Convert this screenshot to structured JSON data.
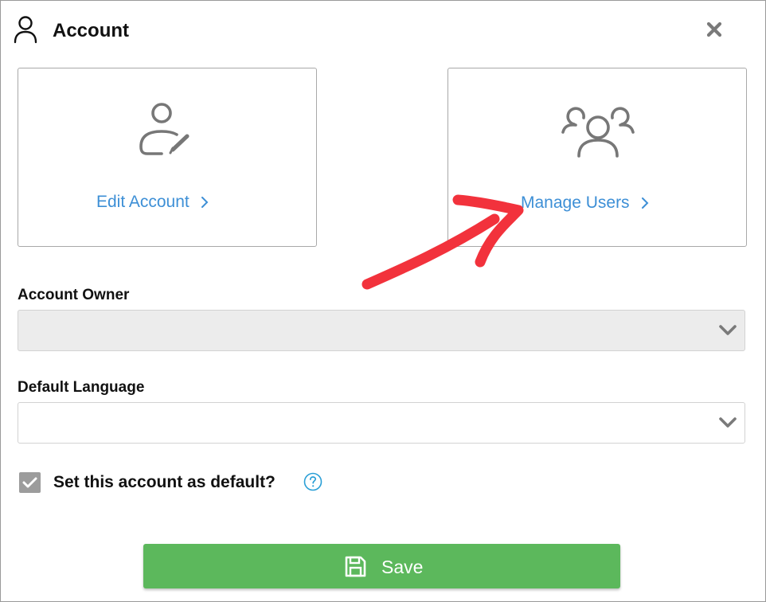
{
  "dialog": {
    "title": "Account",
    "title_icon": "user-icon",
    "close_icon": "close-icon"
  },
  "cards": [
    {
      "label": "Edit Account",
      "icon": "user-edit-icon",
      "chevron": "chevron-right-icon"
    },
    {
      "label": "Manage Users",
      "icon": "users-group-icon",
      "chevron": "chevron-right-icon"
    }
  ],
  "form": {
    "account_owner": {
      "label": "Account Owner",
      "value": "",
      "disabled": true
    },
    "default_language": {
      "label": "Default Language",
      "value": ""
    },
    "set_default": {
      "label": "Set this account as default?",
      "checked": true,
      "help_icon": "help-icon"
    }
  },
  "save_button": {
    "label": "Save",
    "icon": "floppy-disk-icon",
    "color": "#5cb85c"
  },
  "colors": {
    "link": "#3d8fd6",
    "annotation_arrow": "#f2323c"
  }
}
